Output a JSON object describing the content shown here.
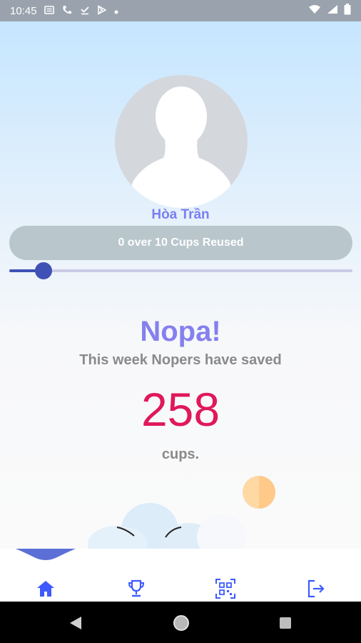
{
  "status_bar": {
    "time": "10:45",
    "icons_left": [
      "message-icon",
      "phone-icon",
      "download-done-icon",
      "play-store-icon",
      "dot-icon"
    ],
    "icons_right": [
      "wifi-icon",
      "signal-icon",
      "battery-icon"
    ]
  },
  "profile": {
    "name": "Hòa Trần",
    "progress_label": "0 over 10 Cups Reused",
    "progress_fraction": 0.1
  },
  "stats": {
    "brand": "Nopa!",
    "subtitle": "This week Nopers have saved",
    "count": "258",
    "unit": "cups."
  },
  "bottom_nav": {
    "items": [
      "home-icon",
      "trophy-icon",
      "qr-code-icon",
      "logout-icon"
    ],
    "active_index": 0
  },
  "colors": {
    "accent": "#3f51b5",
    "brand": "#8580ee",
    "count": "#e0185a"
  }
}
